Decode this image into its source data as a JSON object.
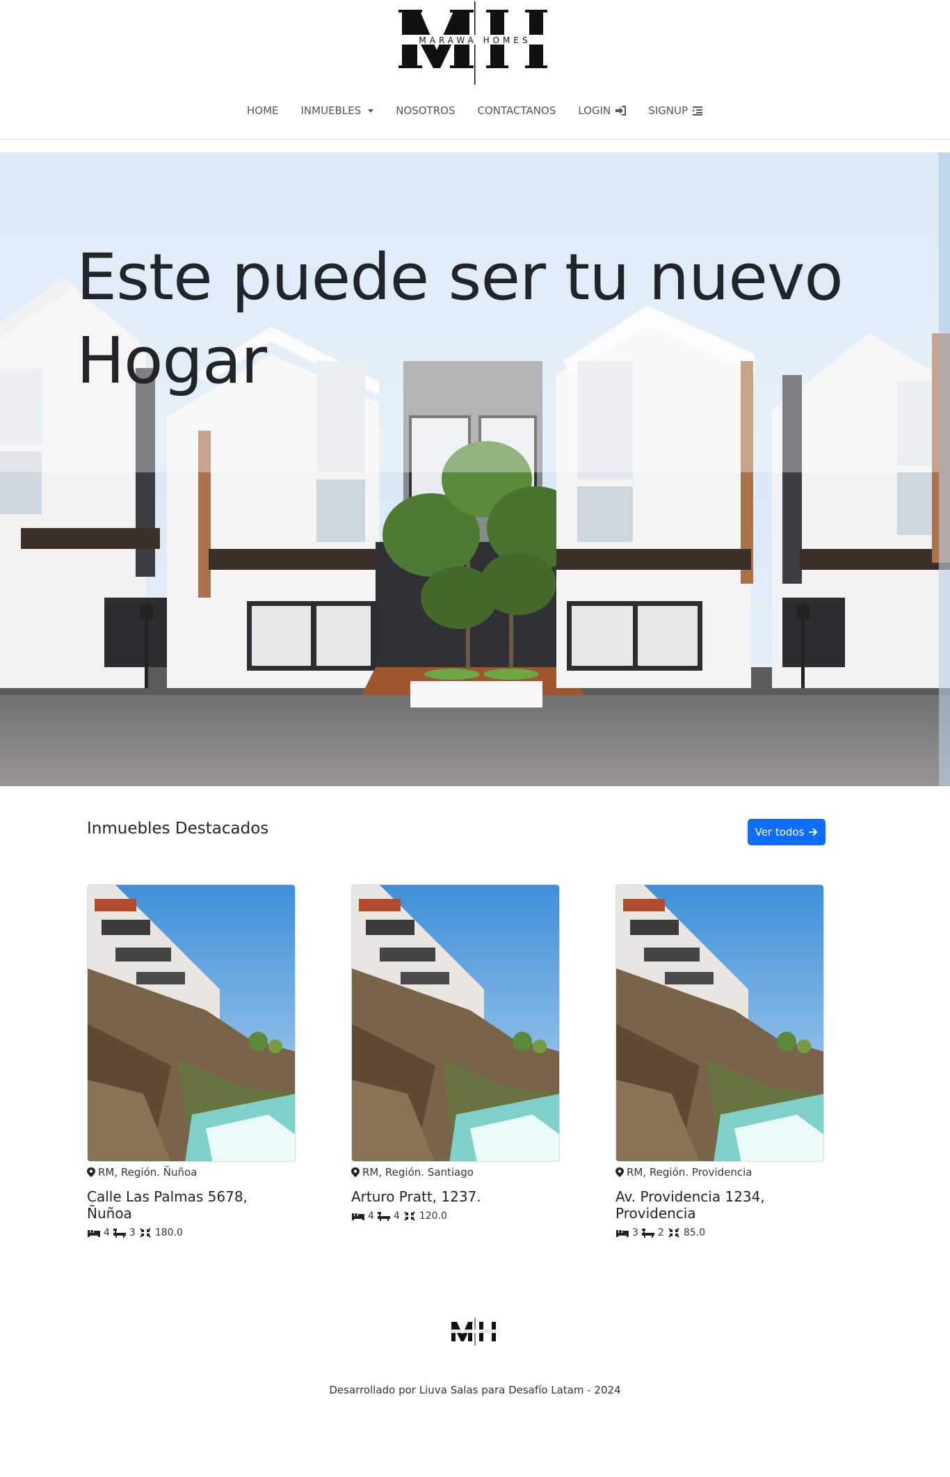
{
  "brand": {
    "name": "MARAWA HOMES",
    "monogram": "MH"
  },
  "nav": {
    "items": [
      {
        "label": "HOME"
      },
      {
        "label": "INMUEBLES"
      },
      {
        "label": "NOSOTROS"
      },
      {
        "label": "CONTACTANOS"
      },
      {
        "label": "LOGIN"
      },
      {
        "label": "SIGNUP"
      }
    ]
  },
  "hero": {
    "title": "Este puede ser tu nuevo Hogar"
  },
  "featured": {
    "title": "Inmuebles Destacados",
    "button_label": "Ver todos",
    "cards": [
      {
        "location": "RM, Región. Ñuñoa",
        "address": "Calle Las Palmas 5678, Ñuñoa",
        "bedrooms": "4",
        "bathrooms": "3",
        "area": "180.0"
      },
      {
        "location": "RM, Región. Santiago",
        "address": "Arturo Pratt, 1237.",
        "bedrooms": "4",
        "bathrooms": "4",
        "area": "120.0"
      },
      {
        "location": "RM, Región. Providencia",
        "address": "Av. Providencia 1234, Providencia",
        "bedrooms": "3",
        "bathrooms": "2",
        "area": "85.0"
      }
    ]
  },
  "footer": {
    "text": "Desarrollado por Liuva Salas para Desafío Latam - 2024"
  },
  "colors": {
    "primary": "#0d6efd",
    "text": "#212529",
    "nav_text": "#555555"
  },
  "icons": [
    "arrow-right-in-icon",
    "signup-list-icon",
    "arrow-right-icon",
    "map-pin-icon",
    "bed-icon",
    "bath-icon",
    "area-icon",
    "chevron-down-icon"
  ]
}
